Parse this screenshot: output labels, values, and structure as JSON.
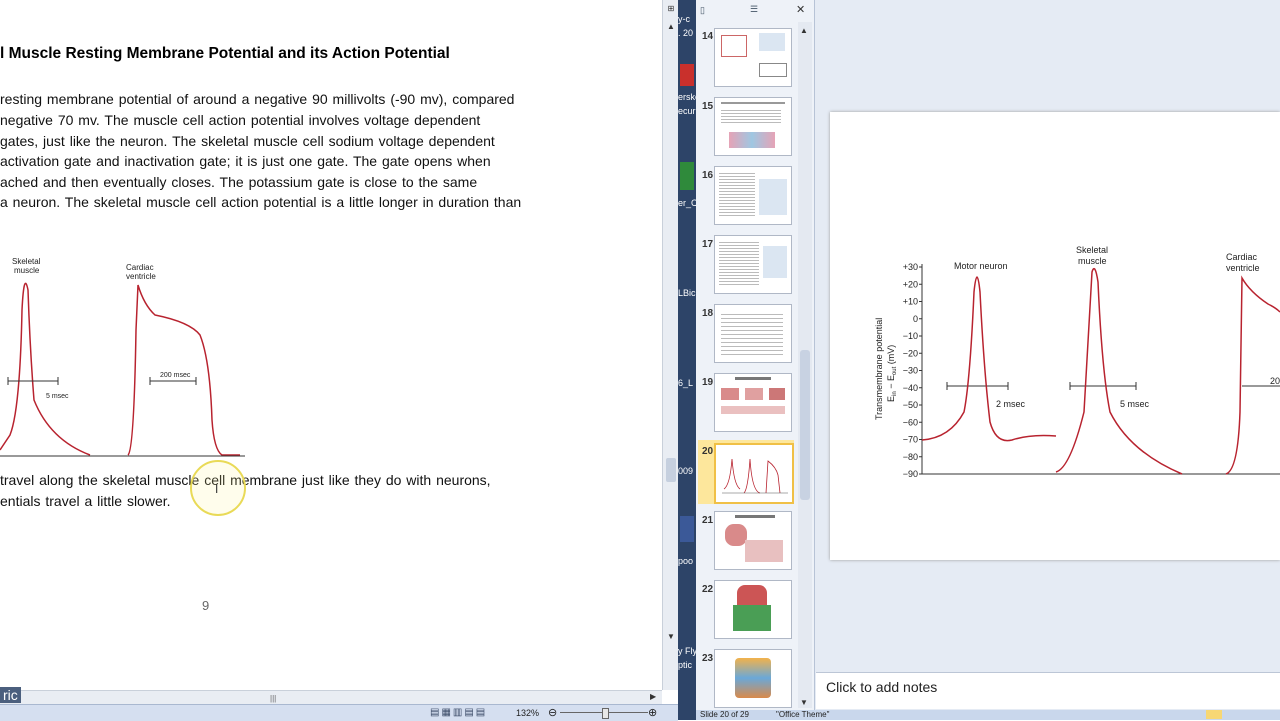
{
  "word": {
    "title": "l Muscle Resting Membrane Potential and its Action Potential",
    "paragraph": [
      "resting membrane potential of around a negative 90 millivolts (-90 mv), compared",
      "negative 70 mv.  The muscle cell action potential involves voltage dependent",
      " gates, just like the neuron.  The skeletal muscle cell sodium voltage dependent",
      " activation gate and inactivation gate; it is just one gate.  The gate opens when",
      "ached and then eventually closes. The potassium gate is close to the same",
      "a neuron. The skeletal muscle cell action potential is a little longer in duration than"
    ],
    "figure": {
      "label_skeletal": "Skeletal\nmuscle",
      "label_cardiac": "Cardiac\nventricle",
      "scale_5": "5 msec",
      "scale_200": "200 msec"
    },
    "paragraph2": [
      "travel along the skeletal muscle cell membrane just like they do with neurons,",
      "entials travel a little slower."
    ],
    "page_number": "9",
    "status_zoom": "132%",
    "bottom_left_text": "ric"
  },
  "taskbar": {
    "labels": [
      "y-c",
      ". 20",
      "Bo",
      "erske",
      "ecur",
      "er_C",
      "LBic",
      "6_L",
      "009",
      "y Fly",
      "ptic",
      "poo"
    ]
  },
  "ppt": {
    "thumbnails": [
      {
        "num": "14"
      },
      {
        "num": "15"
      },
      {
        "num": "16"
      },
      {
        "num": "17"
      },
      {
        "num": "18"
      },
      {
        "num": "19"
      },
      {
        "num": "20"
      },
      {
        "num": "21"
      },
      {
        "num": "22"
      },
      {
        "num": "23"
      }
    ],
    "selected": "20",
    "slide": {
      "ylabel_line1": "Transmembrane potential",
      "ylabel_line2": "E",
      "ticks": [
        "+30",
        "+20",
        "+10",
        "0",
        "−10",
        "−20",
        "−30",
        "−40",
        "−50",
        "−60",
        "−70",
        "−80",
        "−90"
      ],
      "label_motor": "Motor neuron",
      "label_skeletal": "Skeletal\nmuscle",
      "label_cardiac": "Cardiac\nventricle",
      "scale_2": "2 msec",
      "scale_5": "5 msec",
      "scale_20": "20"
    },
    "notes_placeholder": "Click to add notes",
    "status_left": "Slide 20 of 29",
    "status_theme": "\"Office Theme\""
  },
  "colors": {
    "trace": "#b8232f",
    "accent": "#f0c046"
  }
}
